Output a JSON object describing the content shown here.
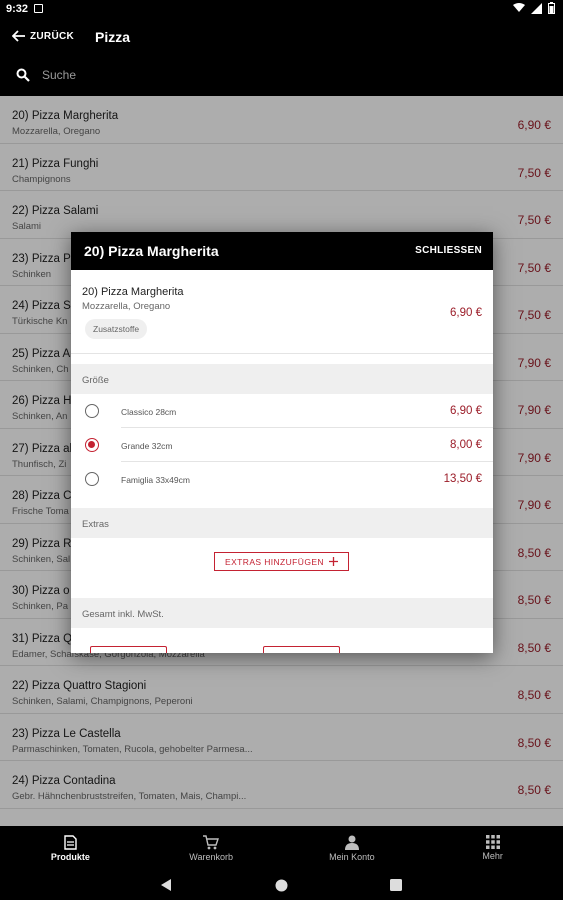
{
  "status_bar": {
    "time": "9:32"
  },
  "header": {
    "back_label": "ZURÜCK",
    "title": "Pizza",
    "search_placeholder": "Suche"
  },
  "products": [
    {
      "name": "20) Pizza Margherita",
      "desc": "Mozzarella, Oregano",
      "price": "6,90 €"
    },
    {
      "name": "21) Pizza Funghi",
      "desc": "Champignons",
      "price": "7,50 €"
    },
    {
      "name": "22) Pizza Salami",
      "desc": "Salami",
      "price": "7,50 €"
    },
    {
      "name": "23) Pizza Pr",
      "desc": "Schinken",
      "price": "7,50 €"
    },
    {
      "name": "24) Pizza Su",
      "desc": "Türkische Kn",
      "price": "7,50 €"
    },
    {
      "name": "25) Pizza An",
      "desc": "Schinken, Ch",
      "price": "7,90 €"
    },
    {
      "name": "26) Pizza Ha",
      "desc": "Schinken, An",
      "price": "7,90 €"
    },
    {
      "name": "27) Pizza al",
      "desc": "Thunfisch, Zi",
      "price": "7,90 €"
    },
    {
      "name": "28) Pizza Ca",
      "desc": "Frische Toma",
      "price": "7,90 €"
    },
    {
      "name": "29) Pizza Ri",
      "desc": "Schinken, Sal",
      "price": "8,50 €"
    },
    {
      "name": "30) Pizza o",
      "desc": "Schinken, Pa",
      "price": "8,50 €"
    },
    {
      "name": "31) Pizza Q",
      "desc": "Edamer, Schafskäse, Gorgonzola, Mozzarella",
      "price": "8,50 €"
    },
    {
      "name": "22) Pizza Quattro Stagioni",
      "desc": "Schinken, Salami, Champignons, Peperoni",
      "price": "8,50 €"
    },
    {
      "name": "23) Pizza Le Castella",
      "desc": "Parmaschinken, Tomaten, Rucola, gehobelter Parmesa...",
      "price": "8,50 €"
    },
    {
      "name": "24) Pizza Contadina",
      "desc": "Gebr. Hähnchenbruststreifen, Tomaten, Mais, Champi...",
      "price": "8,50 €"
    },
    {
      "name": "",
      "desc": "",
      "price": ""
    }
  ],
  "dialog": {
    "title": "20) Pizza Margherita",
    "close_label": "SCHLIESSEN",
    "product": {
      "name": "20) Pizza Margherita",
      "desc": "Mozzarella, Oregano",
      "price": "6,90 €",
      "chip": "Zusatzstoffe"
    },
    "size_section": "Größe",
    "sizes": [
      {
        "label": "Classico 28cm",
        "price": "6,90 €",
        "selected": false
      },
      {
        "label": "Grande 32cm",
        "price": "8,00 €",
        "selected": true
      },
      {
        "label": "Famiglia 33x49cm",
        "price": "13,50 €",
        "selected": false
      }
    ],
    "extras_section": "Extras",
    "extras_button": "EXTRAS HINZUFÜGEN",
    "total_section": "Gesamt inkl. MwSt."
  },
  "bottom_nav": [
    {
      "label": "Produkte",
      "icon": "document-icon",
      "active": true
    },
    {
      "label": "Warenkorb",
      "icon": "cart-icon",
      "active": false
    },
    {
      "label": "Mein Konto",
      "icon": "person-icon",
      "active": false
    },
    {
      "label": "Mehr",
      "icon": "grid-icon",
      "active": false
    }
  ],
  "colors": {
    "accent": "#c42232",
    "price": "#9b1c28",
    "header": "#000000"
  }
}
